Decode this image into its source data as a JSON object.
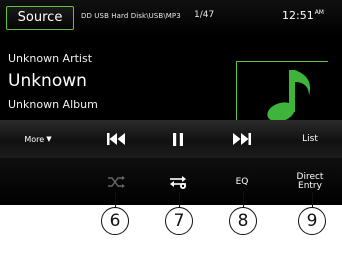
{
  "header": {
    "source_label": "Source",
    "path": "DD USB Hard Disk\\USB\\MP3",
    "track_count": "1/47",
    "time": "12:51",
    "ampm": "AM"
  },
  "track": {
    "artist": "Unknown Artist",
    "title": "Unknown",
    "album": "Unknown Album"
  },
  "transport": {
    "more_label": "More",
    "list_label": "List"
  },
  "functions": {
    "eq_label": "EQ",
    "direct_entry_line1": "Direct",
    "direct_entry_line2": "Entry"
  },
  "callouts": [
    "6",
    "7",
    "8",
    "9"
  ],
  "colors": {
    "accent": "#5fc23a",
    "music_note": "#3fb43a",
    "screen_bg": "#000000"
  },
  "icons": {
    "album_art": "music-note-icon",
    "prev": "skip-previous-icon",
    "pause": "pause-icon",
    "next": "skip-next-icon",
    "shuffle": "shuffle-icon",
    "repeat": "repeat-icon"
  }
}
